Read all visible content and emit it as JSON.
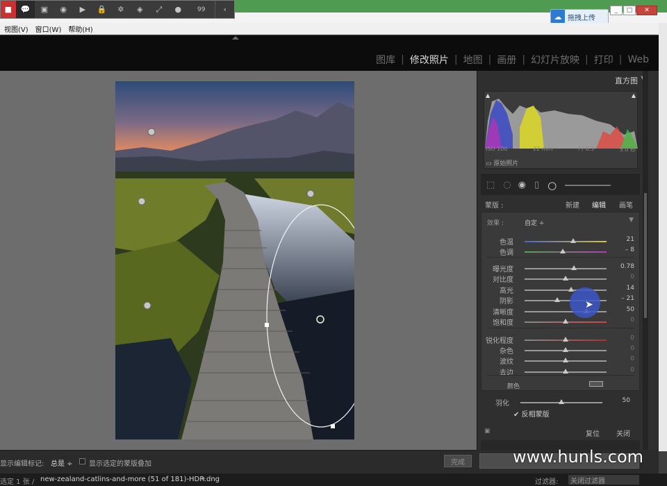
{
  "overlay_toolbar": {
    "count": "99",
    "icons": [
      "stop-icon",
      "chat-icon",
      "gift-icon",
      "circle-icon",
      "camera-icon",
      "lock-icon",
      "gear-icon",
      "box-icon",
      "expand-icon",
      "user-icon"
    ]
  },
  "upload_button": {
    "label": "拖拽上传"
  },
  "menu": {
    "items": [
      "视图(V)",
      "窗口(W)",
      "帮助(H)"
    ]
  },
  "modules": {
    "items": [
      "图库",
      "修改照片",
      "地图",
      "画册",
      "幻灯片放映",
      "打印",
      "Web"
    ],
    "active": "修改照片"
  },
  "histogram": {
    "title": "直方图",
    "iso": "ISO 100",
    "focal": "22 mm",
    "aperture": "f / 6.3",
    "shutter": "5.0 秒",
    "original_label": "原始照片"
  },
  "mask": {
    "label": "蒙版 :",
    "new": "新建",
    "edit": "编辑",
    "brush": "画笔",
    "effect_label": "效果 :",
    "effect_value": "自定 ÷"
  },
  "sliders": {
    "temp": {
      "label": "色温",
      "value": "21",
      "pos": 0.59
    },
    "tint": {
      "label": "色调",
      "value": "– 8",
      "pos": 0.47
    },
    "exposure": {
      "label": "曝光度",
      "value": "0.78",
      "pos": 0.6
    },
    "contrast": {
      "label": "对比度",
      "value": "0",
      "pos": 0.5
    },
    "highlights": {
      "label": "高光",
      "value": "14",
      "pos": 0.57
    },
    "shadows": {
      "label": "阴影",
      "value": "– 21",
      "pos": 0.4
    },
    "clarity": {
      "label": "清晰度",
      "value": "50",
      "pos": 0.75
    },
    "saturation": {
      "label": "饱和度",
      "value": "0",
      "pos": 0.5
    },
    "sharpness": {
      "label": "锐化程度",
      "value": "0",
      "pos": 0.5
    },
    "noise": {
      "label": "杂色",
      "value": "0",
      "pos": 0.5
    },
    "moire": {
      "label": "波纹",
      "value": "0",
      "pos": 0.5
    },
    "defringe": {
      "label": "去边",
      "value": "0",
      "pos": 0.5
    },
    "feather": {
      "label": "羽化",
      "value": "50",
      "pos": 0.5
    }
  },
  "color_label": "颜色",
  "invert_label": "反相蒙版",
  "reset": "复位",
  "close": "关闭",
  "toolbar": {
    "show_marks": "显示编辑标记:",
    "always": "总是 ÷",
    "show_overlay": "显示选定的蒙版叠加",
    "done": "完成"
  },
  "statusbar": {
    "selected": "选定 1 张 /",
    "filename": "new-zealand-catlins-and-more (51 of 181)-HDR.dng",
    "filter_label": "过滤器:",
    "filter_value": "关闭过滤器"
  },
  "watermark": "www.hunls.com",
  "colors": {
    "accent": "#3d57c9",
    "brand_green": "#4e9b51"
  }
}
